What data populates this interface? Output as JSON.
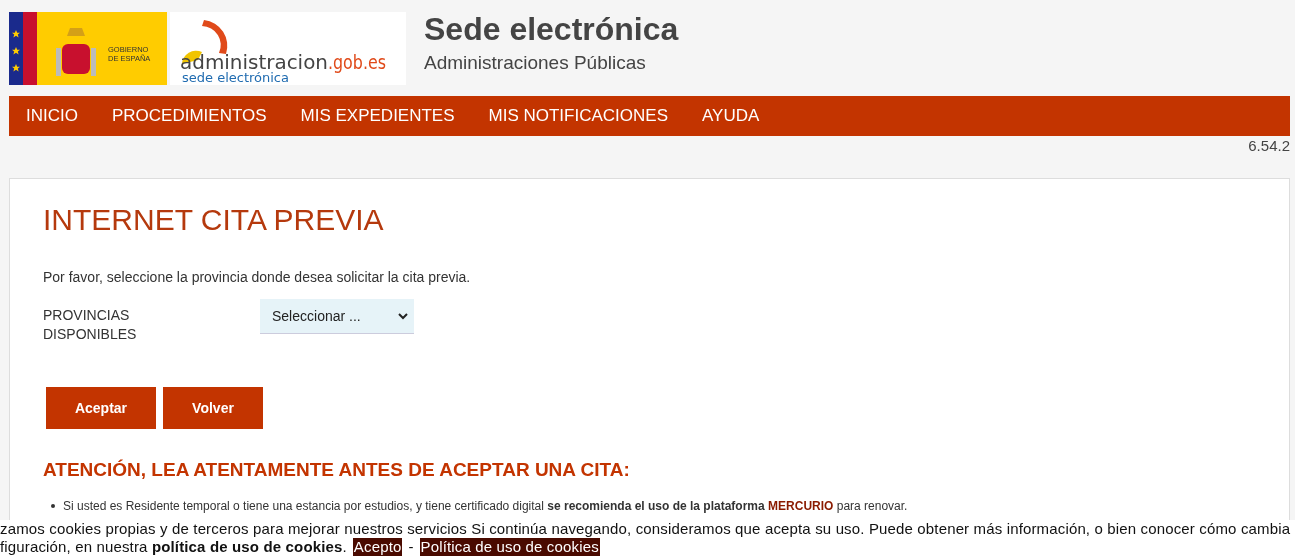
{
  "header": {
    "gov_logo_text": [
      "GOBIERNO",
      "DE ESPAÑA"
    ],
    "admin_logo": {
      "name": "administracion",
      "domain": ".gob.es",
      "subtitle": "sede electrónica"
    },
    "title": "Sede electrónica",
    "subtitle": "Administraciones Públicas"
  },
  "nav": [
    {
      "label": "INICIO"
    },
    {
      "label": "PROCEDIMIENTOS"
    },
    {
      "label": "MIS EXPEDIENTES"
    },
    {
      "label": "MIS NOTIFICACIONES"
    },
    {
      "label": "AYUDA"
    }
  ],
  "version": "6.54.2",
  "page": {
    "title": "INTERNET CITA PREVIA",
    "intro": "Por favor, seleccione la provincia donde desea solicitar la cita previa.",
    "field_label": "PROVINCIAS DISPONIBLES",
    "select_value": "Seleccionar ...",
    "buttons": [
      "Aceptar",
      "Volver"
    ],
    "warning_title": "ATENCIÓN, LEA ATENTAMENTE ANTES DE ACEPTAR UNA CITA:",
    "bullets": [
      {
        "text": "Si usted es Residente temporal o tiene una estancia por estudios, y tiene certificado digital **se recomienda el uso de la plataforma**",
        "link": "MERCURIO",
        "after": "para renovar."
      }
    ]
  },
  "cookie_bar": {
    "lines": [
      "zamos cookies propias y de terceros para mejorar nuestros servicios Si continúa navegando, consideramos que acepta su uso. Puede obtener más información, o bien conocer cómo cambia",
      "figuración, en nuestra **política de uso de cookies**."
    ],
    "accept": "Acepto",
    "separator": "-",
    "policy_link": "Política de uso de cookies"
  }
}
